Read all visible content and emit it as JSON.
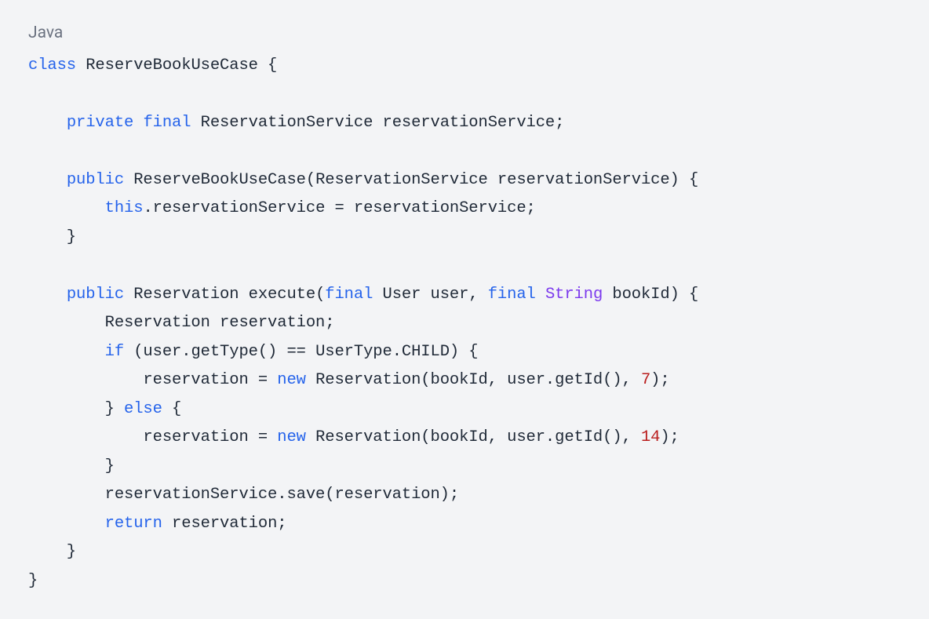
{
  "language": "Java",
  "code": {
    "tokens": [
      {
        "t": "class",
        "c": "kw"
      },
      {
        "t": " ReserveBookUseCase {",
        "c": "plain"
      },
      {
        "t": "\n",
        "c": ""
      },
      {
        "t": "\n",
        "c": ""
      },
      {
        "t": "    ",
        "c": ""
      },
      {
        "t": "private",
        "c": "kw"
      },
      {
        "t": " ",
        "c": ""
      },
      {
        "t": "final",
        "c": "kw"
      },
      {
        "t": " ReservationService reservationService;",
        "c": "plain"
      },
      {
        "t": "\n",
        "c": ""
      },
      {
        "t": "\n",
        "c": ""
      },
      {
        "t": "    ",
        "c": ""
      },
      {
        "t": "public",
        "c": "kw"
      },
      {
        "t": " ReserveBookUseCase(ReservationService reservationService) {",
        "c": "plain"
      },
      {
        "t": "\n",
        "c": ""
      },
      {
        "t": "        ",
        "c": ""
      },
      {
        "t": "this",
        "c": "kw"
      },
      {
        "t": ".reservationService = reservationService;",
        "c": "plain"
      },
      {
        "t": "\n",
        "c": ""
      },
      {
        "t": "    }",
        "c": "plain"
      },
      {
        "t": "\n",
        "c": ""
      },
      {
        "t": "\n",
        "c": ""
      },
      {
        "t": "    ",
        "c": ""
      },
      {
        "t": "public",
        "c": "kw"
      },
      {
        "t": " Reservation execute(",
        "c": "plain"
      },
      {
        "t": "final",
        "c": "kw"
      },
      {
        "t": " User user, ",
        "c": "plain"
      },
      {
        "t": "final",
        "c": "kw"
      },
      {
        "t": " ",
        "c": ""
      },
      {
        "t": "String",
        "c": "type"
      },
      {
        "t": " bookId) {",
        "c": "plain"
      },
      {
        "t": "\n",
        "c": ""
      },
      {
        "t": "        Reservation reservation;",
        "c": "plain"
      },
      {
        "t": "\n",
        "c": ""
      },
      {
        "t": "        ",
        "c": ""
      },
      {
        "t": "if",
        "c": "kw"
      },
      {
        "t": " (user.getType() == UserType.CHILD) {",
        "c": "plain"
      },
      {
        "t": "\n",
        "c": ""
      },
      {
        "t": "            reservation = ",
        "c": "plain"
      },
      {
        "t": "new",
        "c": "kw"
      },
      {
        "t": " Reservation(bookId, user.getId(), ",
        "c": "plain"
      },
      {
        "t": "7",
        "c": "num"
      },
      {
        "t": ");",
        "c": "plain"
      },
      {
        "t": "\n",
        "c": ""
      },
      {
        "t": "        } ",
        "c": "plain"
      },
      {
        "t": "else",
        "c": "kw"
      },
      {
        "t": " {",
        "c": "plain"
      },
      {
        "t": "\n",
        "c": ""
      },
      {
        "t": "            reservation = ",
        "c": "plain"
      },
      {
        "t": "new",
        "c": "kw"
      },
      {
        "t": " Reservation(bookId, user.getId(), ",
        "c": "plain"
      },
      {
        "t": "14",
        "c": "num"
      },
      {
        "t": ");",
        "c": "plain"
      },
      {
        "t": "\n",
        "c": ""
      },
      {
        "t": "        }",
        "c": "plain"
      },
      {
        "t": "\n",
        "c": ""
      },
      {
        "t": "        reservationService.save(reservation);",
        "c": "plain"
      },
      {
        "t": "\n",
        "c": ""
      },
      {
        "t": "        ",
        "c": ""
      },
      {
        "t": "return",
        "c": "kw"
      },
      {
        "t": " reservation;",
        "c": "plain"
      },
      {
        "t": "\n",
        "c": ""
      },
      {
        "t": "    }",
        "c": "plain"
      },
      {
        "t": "\n",
        "c": ""
      },
      {
        "t": "}",
        "c": "plain"
      }
    ]
  }
}
